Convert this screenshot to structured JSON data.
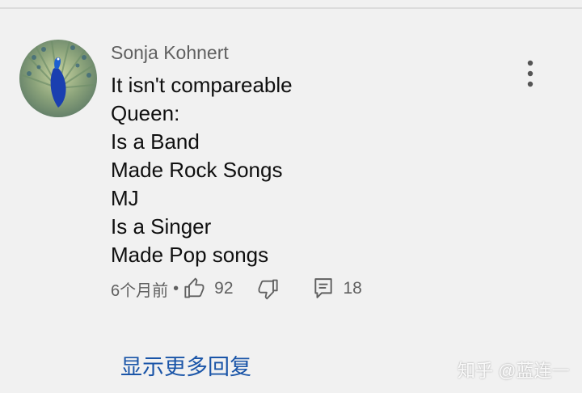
{
  "comment": {
    "author": "Sonja Kohnert",
    "avatar_icon": "peacock-avatar",
    "lines": [
      "It isn't compareable",
      "Queen:",
      "Is a Band",
      "Made Rock Songs",
      "MJ",
      "Is a Singer",
      "Made Pop songs"
    ],
    "timestamp": "6个月前",
    "separator": "•",
    "like_count": "92",
    "reply_count": "18",
    "icons": {
      "like": "thumbs-up-icon",
      "dislike": "thumbs-down-icon",
      "reply": "reply-icon",
      "more": "more-vertical-icon"
    }
  },
  "show_more_replies": "显示更多回复",
  "watermark": "知乎 @蓝连一",
  "colors": {
    "background": "#f1f1f1",
    "link": "#1a55a8",
    "secondary_text": "#606060",
    "primary_text": "#0f0f0f"
  }
}
